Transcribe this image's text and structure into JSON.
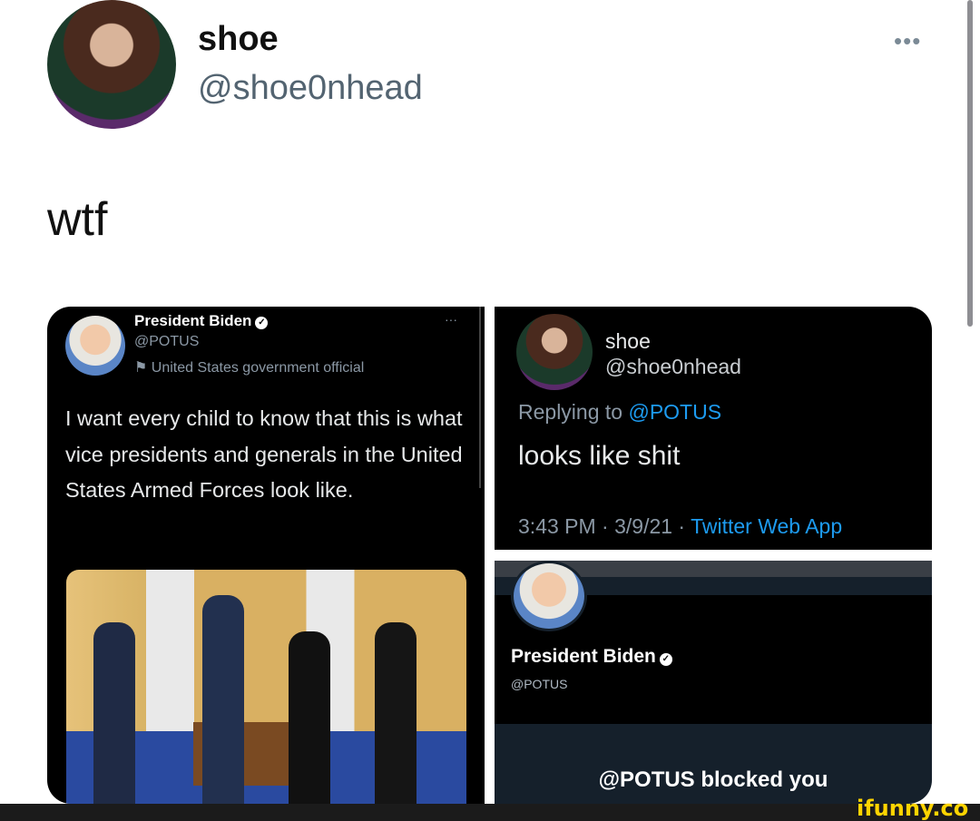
{
  "header": {
    "name": "shoe",
    "handle": "@shoe0nhead",
    "more": "•••"
  },
  "tweet": {
    "text": "wtf"
  },
  "left_card": {
    "name": "President Biden",
    "handle": "@POTUS",
    "label": "United States government official",
    "more": "···",
    "body": "I want every child to know that this is what vice presidents and generals in the United States Armed Forces look like."
  },
  "right_top_card": {
    "name": "shoe",
    "handle": "@shoe0nhead",
    "replying_prefix": "Replying to ",
    "replying_handle": "@POTUS",
    "body": "looks like shit",
    "time": "3:43 PM · 3/9/21 · ",
    "app": "Twitter Web App"
  },
  "right_bottom_card": {
    "name": "President Biden",
    "handle": "@POTUS",
    "blocked_message": "@POTUS blocked you"
  },
  "watermark": "ifunny.co",
  "colors": {
    "link": "#1d9bf0",
    "watermark": "#ffd400"
  }
}
